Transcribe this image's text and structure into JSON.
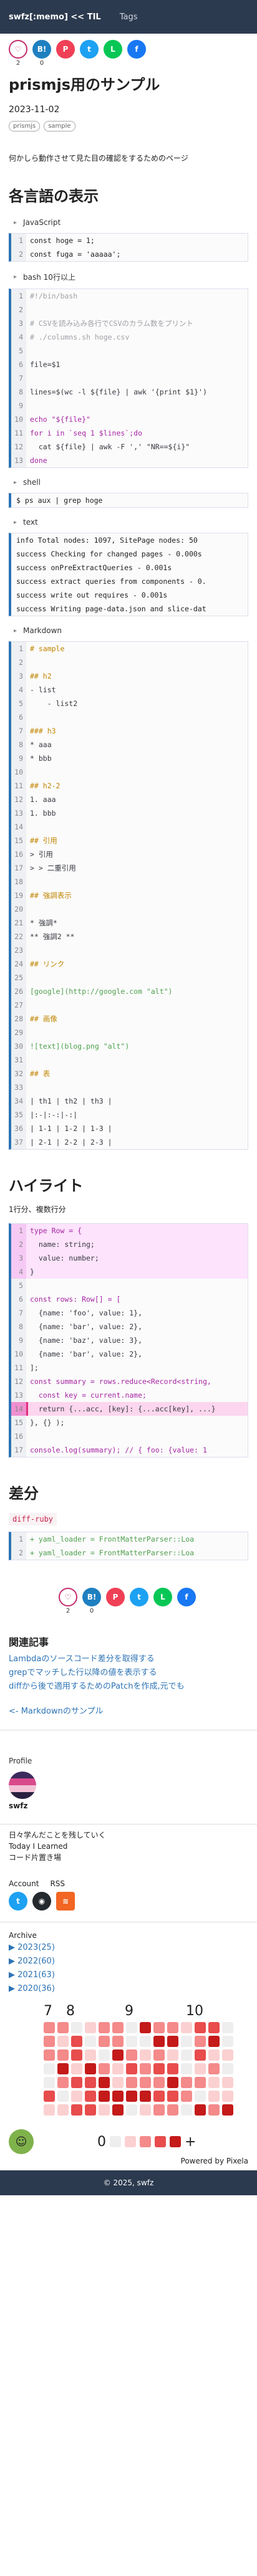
{
  "header": {
    "brand": "swfz[:memo] << TIL",
    "tags": "Tags"
  },
  "share": [
    {
      "name": "hatena",
      "color": "#c42f6f",
      "glyph": "♡",
      "count": "2",
      "outline": true
    },
    {
      "name": "hatebu",
      "color": "#1f80c0",
      "glyph": "B!",
      "count": "0"
    },
    {
      "name": "pocket",
      "color": "#ef4056",
      "glyph": "P",
      "count": ""
    },
    {
      "name": "twitter",
      "color": "#1da1f2",
      "glyph": "t",
      "count": ""
    },
    {
      "name": "line",
      "color": "#06c755",
      "glyph": "L",
      "count": ""
    },
    {
      "name": "facebook",
      "color": "#1877f2",
      "glyph": "f",
      "count": ""
    }
  ],
  "post": {
    "title": "prismjs用のサンプル",
    "date": "2023-11-02",
    "tags": [
      "prismjs",
      "sample"
    ],
    "lead": "何かしら動作させて見た目の確認をするためのページ",
    "section1": "各言語の表示",
    "section2": "ハイライト",
    "highlight_note": "1行分、複数行分",
    "section3": "差分",
    "diff_badge": "diff-ruby"
  },
  "blocks": {
    "js_label": "JavaScript",
    "js": [
      "const hoge = 1;",
      "const fuga = 'aaaaa';"
    ],
    "bash_label": "bash 10行以上",
    "bash": [
      "#!/bin/bash",
      "",
      "# CSVを読み込み各行でCSVのカラム数をプリント",
      "# ./columns.sh hoge.csv",
      "",
      "file=$1",
      "",
      "lines=$(wc -l ${file} | awk '{print $1}')",
      "",
      "echo \"${file}\"",
      "for i in `seq 1 $lines`;do",
      "  cat ${file} | awk -F ',' \"NR==${i}\"",
      "done"
    ],
    "shell_label": "shell",
    "shell": [
      "$ ps aux | grep hoge"
    ],
    "text_label": "text",
    "text": [
      "info Total nodes: 1097, SitePage nodes: 50",
      "success Checking for changed pages - 0.000s",
      "success onPreExtractQueries - 0.001s",
      "success extract queries from components - 0.",
      "success write out requires - 0.001s",
      "success Writing page-data.json and slice-dat"
    ],
    "md_label": "Markdown",
    "md": [
      "# sample",
      "",
      "## h2",
      "- list",
      "    - list2",
      "",
      "### h3",
      "* aaa",
      "* bbb",
      "",
      "## h2-2",
      "1. aaa",
      "1. bbb",
      "",
      "## 引用",
      "> 引用",
      "> > 二重引用",
      "",
      "## 強調表示",
      "",
      "* 強調* ",
      "** 強調2 **",
      "",
      "## リンク",
      "",
      "[google](http://google.com \"alt\")",
      "",
      "## 画像",
      "",
      "![text](blog.png \"alt\")",
      "",
      "## 表",
      "",
      "| th1 | th2 | th3 |",
      "|:-|:-:|-:|",
      "| 1-1 | 1-2 | 1-3 |",
      "| 2-1 | 2-2 | 2-3 |"
    ],
    "hl": [
      "type Row = {",
      "  name: string;",
      "  value: number;",
      "}",
      "",
      "const rows: Row[] = [",
      "  {name: 'foo', value: 1},",
      "  {name: 'bar', value: 2},",
      "  {name: 'baz', value: 3},",
      "  {name: 'bar', value: 2},",
      "];",
      "const summary = rows.reduce<Record<string,",
      "  const key = current.name;",
      "  return {...acc, [key]: {...acc[key], ...}",
      "}, {} );",
      "",
      "console.log(summary); // { foo: {value: 1"
    ],
    "diff": [
      "+ yaml_loader = FrontMatterParser::Loa",
      "+ yaml_loader = FrontMatterParser::Loa"
    ]
  },
  "related": {
    "heading": "関連記事",
    "links": [
      "Lambdaのソースコード差分を取得する",
      "grepでマッチした行以降の値を表示する",
      "diffから後で適用するためのPatchを作成,元でも"
    ],
    "back": "<- Markdownのサンプル"
  },
  "sidebar": {
    "profile_h": "Profile",
    "name": "swfz",
    "bio": [
      "日々学んだことを残していく",
      "Today I Learned",
      "コード片置き場"
    ],
    "account_h": "Account",
    "rss_h": "RSS",
    "archive_h": "Archive",
    "archive": [
      "▶ 2023(25)",
      "▶ 2022(60)",
      "▶ 2021(63)",
      "▶ 2020(36)"
    ],
    "months": [
      "7",
      "8",
      "9",
      "10"
    ],
    "legend_left": "0",
    "legend_right": "+",
    "powered": "Powered by Pixela"
  },
  "footer": "© 2025, swfz",
  "colors": {
    "accent": "#2d73b5",
    "header": "#2c3a4f"
  }
}
